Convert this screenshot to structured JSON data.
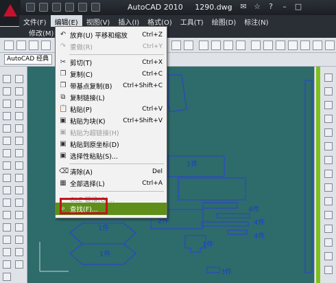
{
  "title": {
    "app": "AutoCAD 2010",
    "file": "1290.dwg"
  },
  "menubar": {
    "row1": [
      "文件(F)",
      "编辑(E)",
      "视图(V)",
      "插入(I)",
      "格式(O)",
      "工具(T)",
      "绘图(D)",
      "标注(N)"
    ],
    "row2": [
      "修改(M)"
    ]
  },
  "workspace": {
    "value": "AutoCAD 经典"
  },
  "edit_menu": {
    "items": [
      {
        "label": "放弃(U) 平移和缩放",
        "shortcut": "Ctrl+Z",
        "icon": "undo-icon"
      },
      {
        "label": "重做(R)",
        "shortcut": "Ctrl+Y",
        "icon": "redo-icon"
      },
      {
        "label": "剪切(T)",
        "shortcut": "Ctrl+X",
        "icon": "cut-icon"
      },
      {
        "label": "复制(C)",
        "shortcut": "Ctrl+C",
        "icon": "copy-icon"
      },
      {
        "label": "带基点复制(B)",
        "shortcut": "Ctrl+Shift+C",
        "icon": "copy-base-icon"
      },
      {
        "label": "复制链接(L)",
        "shortcut": "",
        "icon": "copy-link-icon"
      },
      {
        "label": "粘贴(P)",
        "shortcut": "Ctrl+V",
        "icon": "paste-icon"
      },
      {
        "label": "粘贴为块(K)",
        "shortcut": "Ctrl+Shift+V",
        "icon": "paste-block-icon"
      },
      {
        "label": "粘贴为超链接(H)",
        "shortcut": "",
        "icon": "paste-hyperlink-icon"
      },
      {
        "label": "粘贴到原坐标(D)",
        "shortcut": "",
        "icon": "paste-orig-icon"
      },
      {
        "label": "选择性粘贴(S)...",
        "shortcut": "",
        "icon": "paste-special-icon"
      },
      {
        "label": "清除(A)",
        "shortcut": "Del",
        "icon": "clear-icon"
      },
      {
        "label": "全部选择(L)",
        "shortcut": "Ctrl+A",
        "icon": "select-all-icon"
      },
      {
        "label": "OLE 链接(O)...",
        "shortcut": "",
        "icon": ""
      },
      {
        "label": "查找(F)...",
        "shortcut": "",
        "icon": "find-icon"
      }
    ]
  },
  "drawing_labels": [
    "1件",
    "2件",
    "1件",
    "1件",
    "1件",
    "4件",
    "4件",
    "4件",
    "3件"
  ]
}
